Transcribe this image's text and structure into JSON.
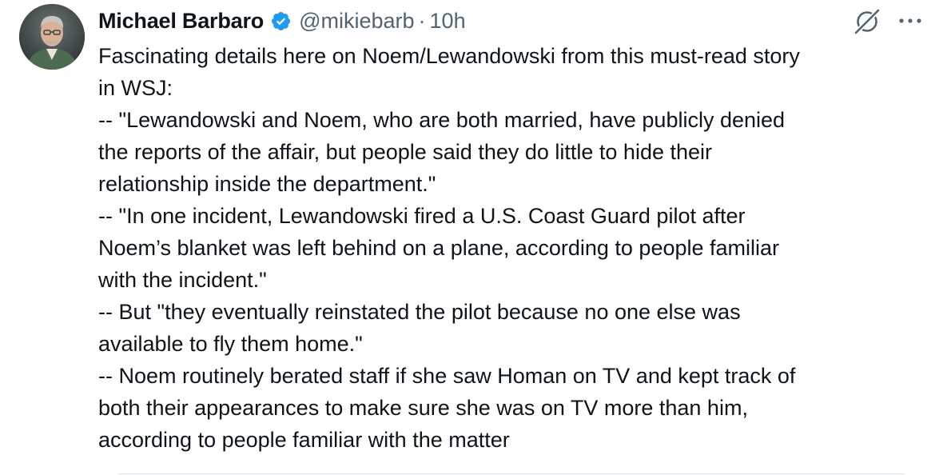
{
  "author": {
    "display_name": "Michael Barbaro",
    "handle": "@mikiebarb",
    "separator": "·",
    "time": "10h",
    "verified": true,
    "verified_color": "#1d9bf0"
  },
  "icons": {
    "verified": "verified-badge-icon",
    "grok": "grok-icon",
    "more": "more-options-icon"
  },
  "tweet": {
    "lines": [
      "Fascinating details here on Noem/Lewandowski from this must-read story",
      "in WSJ:",
      "-- \"Lewandowski and Noem, who are both married, have publicly denied",
      "the reports of the affair, but people said they do little to hide their",
      "relationship inside the department.\"",
      "-- \"In one incident, Lewandowski fired a U.S. Coast Guard pilot after",
      "Noem’s blanket was left behind on a plane, according to people familiar",
      "with the incident.\"",
      "-- But \"they eventually reinstated the pilot because no one else was",
      "available to fly them home.\"",
      "-- Noem routinely berated staff if she saw Homan on TV and kept track of",
      "both their appearances to make sure she was on TV more than him,",
      "according to people familiar with the matter"
    ]
  },
  "colors": {
    "text_primary": "#0f1419",
    "text_secondary": "#536471",
    "divider": "#dfe3e6"
  }
}
